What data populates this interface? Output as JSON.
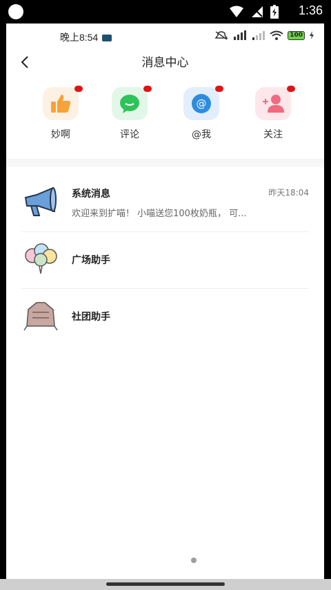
{
  "system_status": {
    "time": "1:36"
  },
  "inner_status": {
    "time": "晚上8:54",
    "battery": "100"
  },
  "header": {
    "title": "消息中心"
  },
  "categories": [
    {
      "label": "妙啊",
      "icon": "thumbs-up-icon",
      "color": "#f7a23a"
    },
    {
      "label": "评论",
      "icon": "comment-icon",
      "color": "#2fc35a"
    },
    {
      "label": "@我",
      "icon": "at-icon",
      "color": "#2d8ce0"
    },
    {
      "label": "关注",
      "icon": "add-follower-icon",
      "color": "#f06a80"
    }
  ],
  "messages": [
    {
      "name": "系统消息",
      "time": "昨天18:04",
      "preview": "欢迎来到扩喵！ 小喵送您100枚奶瓶， 可...",
      "icon": "megaphone-icon"
    },
    {
      "name": "广场助手",
      "icon": "balloons-icon"
    },
    {
      "name": "社团助手",
      "icon": "club-icon"
    }
  ]
}
